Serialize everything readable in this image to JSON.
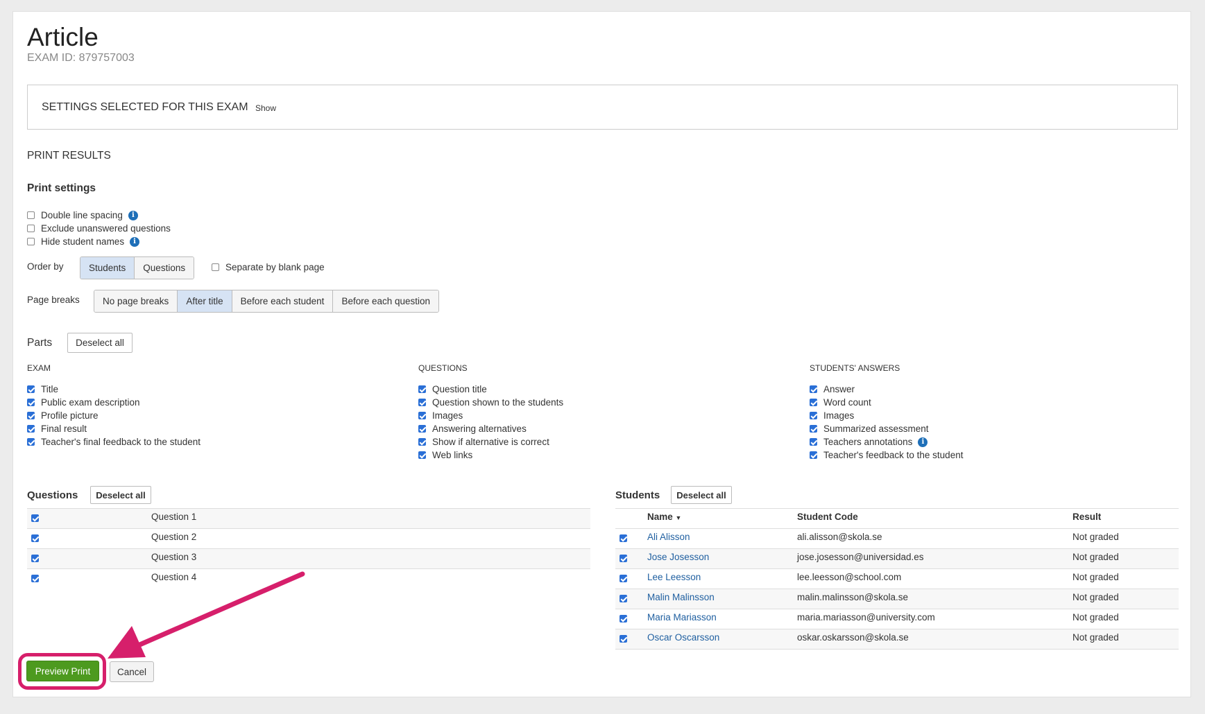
{
  "header": {
    "title": "Article",
    "exam_id": "EXAM ID: 879757003"
  },
  "settings_box": {
    "title": "SETTINGS SELECTED FOR THIS EXAM",
    "show_label": "Show"
  },
  "print_results_label": "PRINT RESULTS",
  "print_settings": {
    "heading": "Print settings",
    "options": [
      {
        "label": "Double line spacing",
        "checked": false,
        "info": true
      },
      {
        "label": "Exclude unanswered questions",
        "checked": false,
        "info": false
      },
      {
        "label": "Hide student names",
        "checked": false,
        "info": true
      }
    ]
  },
  "order_by": {
    "label": "Order by",
    "options": [
      "Students",
      "Questions"
    ],
    "selected": "Students",
    "separate_label": "Separate by blank page",
    "separate_checked": false
  },
  "page_breaks": {
    "label": "Page breaks",
    "options": [
      "No page breaks",
      "After title",
      "Before each student",
      "Before each question"
    ],
    "selected": "After title"
  },
  "parts": {
    "heading": "Parts",
    "deselect_label": "Deselect all",
    "columns": [
      {
        "heading": "EXAM",
        "items": [
          "Title",
          "Public exam description",
          "Profile picture",
          "Final result",
          "Teacher's final feedback to the student"
        ]
      },
      {
        "heading": "QUESTIONS",
        "items": [
          "Question title",
          "Question shown to the students",
          "Images",
          "Answering alternatives",
          "Show if alternative is correct",
          "Web links"
        ]
      },
      {
        "heading": "STUDENTS' ANSWERS",
        "items": [
          "Answer",
          "Word count",
          "Images",
          "Summarized assessment",
          "Teachers annotations",
          "Teacher's feedback to the student"
        ]
      }
    ]
  },
  "questions": {
    "heading": "Questions",
    "deselect_label": "Deselect all",
    "rows": [
      "Question 1",
      "Question 2",
      "Question 3",
      "Question 4"
    ]
  },
  "students": {
    "heading": "Students",
    "deselect_label": "Deselect all",
    "columns": {
      "name": "Name",
      "code": "Student Code",
      "result": "Result"
    },
    "rows": [
      {
        "name": "Ali Alisson",
        "code": "ali.alisson@skola.se",
        "result": "Not graded"
      },
      {
        "name": "Jose Josesson",
        "code": "jose.josesson@universidad.es",
        "result": "Not graded"
      },
      {
        "name": "Lee Leesson",
        "code": "lee.leesson@school.com",
        "result": "Not graded"
      },
      {
        "name": "Malin Malinsson",
        "code": "malin.malinsson@skola.se",
        "result": "Not graded"
      },
      {
        "name": "Maria Mariasson",
        "code": "maria.mariasson@university.com",
        "result": "Not graded"
      },
      {
        "name": "Oscar Oscarsson",
        "code": "oskar.oskarsson@skola.se",
        "result": "Not graded"
      }
    ]
  },
  "footer": {
    "preview_label": "Preview Print",
    "cancel_label": "Cancel"
  },
  "colors": {
    "accent_green": "#4d9a1f",
    "highlight_pink": "#d61f6b",
    "link_blue": "#1f5fa0",
    "checkbox_blue": "#2a6fd6"
  }
}
